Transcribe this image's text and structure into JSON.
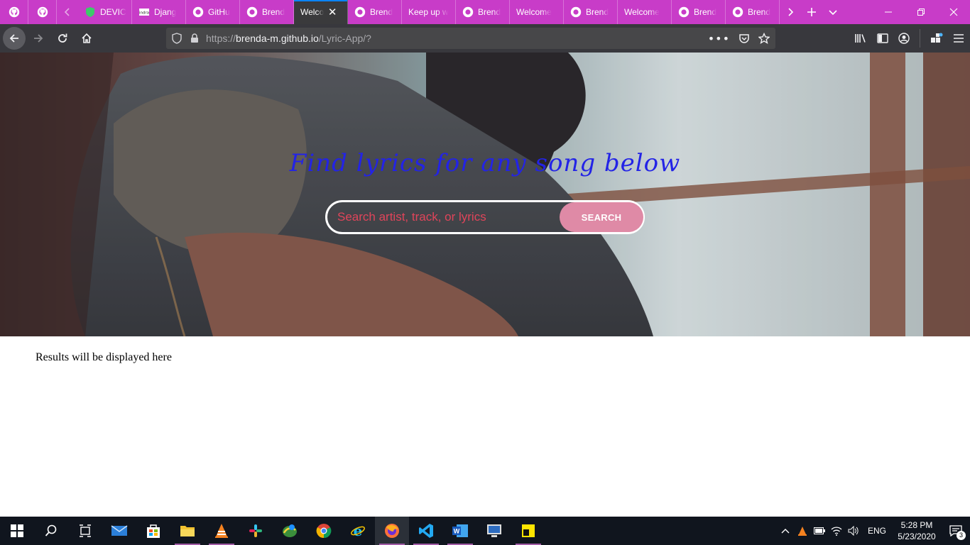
{
  "browser": {
    "tabs": [
      {
        "title": "",
        "icon": "github-icon",
        "pinned": true
      },
      {
        "title": "",
        "icon": "github-icon",
        "pinned": true
      },
      {
        "title": "DEVIC",
        "icon": "shield-icon"
      },
      {
        "title": "Djang",
        "icon": "indra-logo-icon"
      },
      {
        "title": "GitHu",
        "icon": "github-icon"
      },
      {
        "title": "Brend",
        "icon": "github-icon"
      },
      {
        "title": "Welco",
        "icon": "",
        "active": true
      },
      {
        "title": "Brend",
        "icon": "github-icon"
      },
      {
        "title": "Keep up w",
        "icon": ""
      },
      {
        "title": "Brend",
        "icon": "github-icon"
      },
      {
        "title": "Welcome",
        "icon": ""
      },
      {
        "title": "Brend",
        "icon": "github-icon"
      },
      {
        "title": "Welcome",
        "icon": ""
      },
      {
        "title": "Brend",
        "icon": "github-icon"
      },
      {
        "title": "Brend",
        "icon": "github-icon"
      }
    ],
    "url_prefix": "https://",
    "url_host": "brenda-m.github.io",
    "url_path": "/Lyric-App/?",
    "accent_color": "#c83cc8"
  },
  "page": {
    "title": "Find lyrics for any song below",
    "search_placeholder": "Search artist, track, or lyrics",
    "search_button": "SEARCH",
    "results_text": "Results will be displayed here",
    "title_color": "#2323e6",
    "button_color": "#df8aa6"
  },
  "taskbar": {
    "apps": [
      "start-icon",
      "search-icon",
      "task-view-icon",
      "mail-icon",
      "store-icon",
      "file-explorer-icon",
      "vlc-icon",
      "slack-icon",
      "maps-icon",
      "chrome-icon",
      "internet-explorer-icon",
      "firefox-icon",
      "vscode-icon",
      "word-icon",
      "remote-desktop-icon",
      "sticky-notes-icon"
    ],
    "language": "ENG",
    "time": "5:28 PM",
    "date": "5/23/2020",
    "notification_count": "3"
  }
}
